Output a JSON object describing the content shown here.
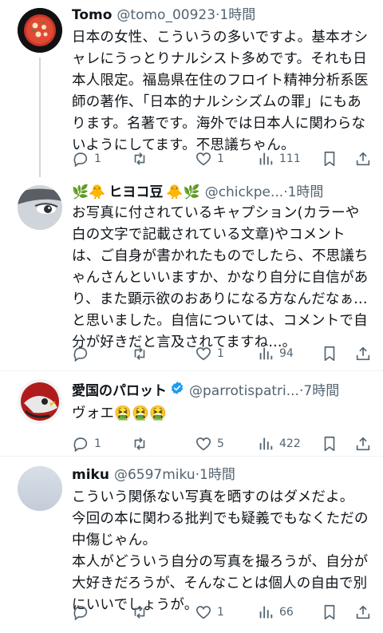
{
  "posts": [
    {
      "name": "Tomo",
      "handle": "@tomo_00923",
      "time": "·1時間",
      "body": "日本の女性、こういうの多いですよ。基本オシャレにうっとりナルシスト多めです。それも日本人限定。福島県在住のフロイト精神分析系医師の著作、「日本的ナルシシズムの罪」にもあります。名著です。海外では日本人に関わらないようにしてます。不思議ちゃん。",
      "reply_count": "1",
      "retweet_count": "",
      "like_count": "1",
      "view_count": "111"
    },
    {
      "name_prefix": "🌿🐥",
      "name": "ヒヨコ豆",
      "name_suffix": "🐥🌿",
      "handle": "@chickpe...",
      "time": "·1時間",
      "body": "お写真に付されているキャプション(カラーや白の文字で記載されている文章)やコメントは、ご自身が書かれたものでしたら、不思議ちゃんさんといいますか、かなり自分に自信があり、また顕示欲のおありになる方なんだなぁ...と思いました。自信については、コメントで自分が好きだと言及されてますね...。",
      "reply_count": "",
      "retweet_count": "",
      "like_count": "1",
      "view_count": "94"
    },
    {
      "name": "愛国のパロット",
      "handle": "@parrotispatri...",
      "time": "·7時間",
      "body": "ヴォエ🤮🤮🤮",
      "reply_count": "1",
      "retweet_count": "",
      "like_count": "5",
      "view_count": "422"
    },
    {
      "name": "miku",
      "handle": "@6597miku",
      "time": "·1時間",
      "body": "こういう関係ない写真を晒すのはダメだよ。\n今回の本に関わる批判でも疑義でもなくただの中傷じゃん。\n本人がどういう自分の写真を撮ろうが、自分が大好きだろうが、そんなことは個人の自由で別にいいでしょうが。",
      "reply_count": "",
      "retweet_count": "",
      "like_count": "1",
      "view_count": "66"
    }
  ],
  "colors": {
    "text": "#0f1419",
    "secondary": "#536471",
    "verified": "#1d9bf0",
    "thread_line": "#cfd9de",
    "divider": "#eff3f4"
  },
  "icons": [
    "reply-icon",
    "retweet-icon",
    "like-icon",
    "views-icon",
    "bookmark-icon",
    "share-icon",
    "verified-badge-icon"
  ]
}
